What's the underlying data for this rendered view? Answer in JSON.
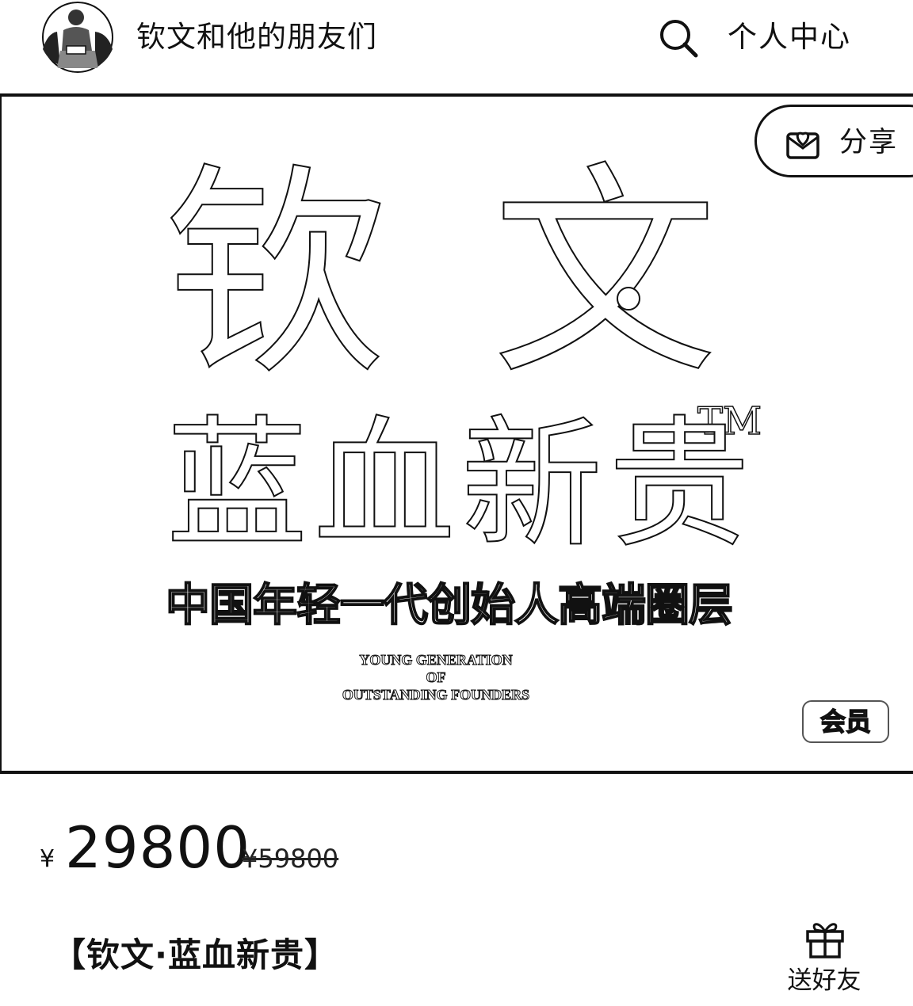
{
  "header": {
    "shop_name": "钦文和他的朋友们",
    "avatar_icon": "person-reading-avatar",
    "search_icon": "search-icon",
    "personal_center": "个人中心"
  },
  "banner": {
    "share_label": "分享",
    "share_icon": "share-icon",
    "brand_line1": "钦 文",
    "brand_line2": "蓝血新贵",
    "tm": "TM",
    "slogan_cn": "中国年轻一代创始人高端圈层",
    "slogan_en": [
      "YOUNG GENERATION",
      "OF",
      "OUTSTANDING FOUNDERS"
    ],
    "member_badge": "会员"
  },
  "price": {
    "currency": "¥",
    "current": "29800",
    "original": "¥59800"
  },
  "product": {
    "title": "【钦文·蓝血新贵】",
    "gift_label": "送好友",
    "gift_icon": "gift-icon"
  }
}
